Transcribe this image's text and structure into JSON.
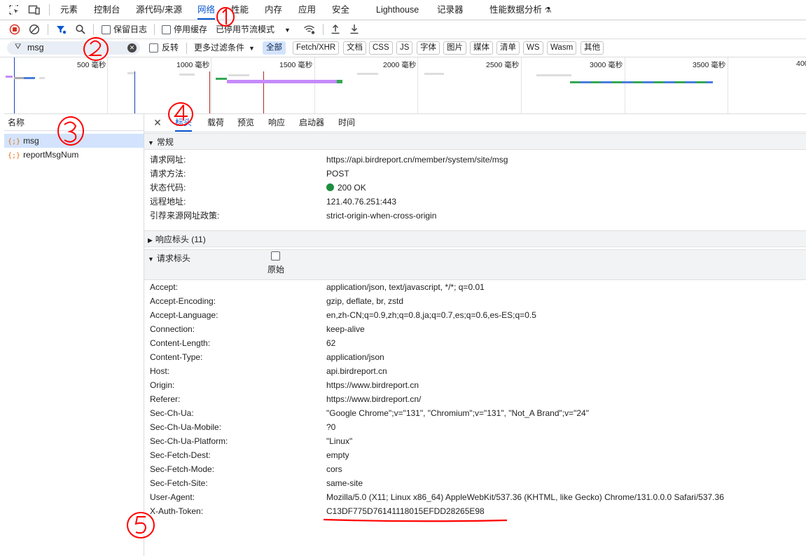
{
  "tabs": {
    "elements": "元素",
    "console": "控制台",
    "sources": "源代码/来源",
    "network": "网络",
    "performance": "性能",
    "memory": "内存",
    "application": "应用",
    "security": "安全",
    "lighthouse": "Lighthouse",
    "recorder": "记录器",
    "performance_insights": "性能数据分析"
  },
  "toolbar": {
    "preserve_log": "保留日志",
    "disable_cache": "停用缓存",
    "throttling": "已停用节流模式"
  },
  "filter": {
    "value": "msg",
    "invert": "反转",
    "more_filters": "更多过滤条件",
    "types": [
      "全部",
      "Fetch/XHR",
      "文档",
      "CSS",
      "JS",
      "字体",
      "图片",
      "媒体",
      "清单",
      "WS",
      "Wasm",
      "其他"
    ],
    "active_type": "全部"
  },
  "timeline": {
    "ticks": [
      "500 毫秒",
      "1000 毫秒",
      "1500 毫秒",
      "2000 毫秒",
      "2500 毫秒",
      "3000 毫秒",
      "3500 毫秒",
      "400"
    ]
  },
  "requests": {
    "header": "名称",
    "items": [
      {
        "name": "msg",
        "selected": true
      },
      {
        "name": "reportMsgNum",
        "selected": false
      }
    ]
  },
  "details": {
    "tabs": [
      "标头",
      "载荷",
      "预览",
      "响应",
      "启动器",
      "时间"
    ],
    "active_tab": "标头",
    "general": {
      "title": "常规",
      "rows": [
        {
          "key": "请求网址:",
          "value": "https://api.birdreport.cn/member/system/site/msg"
        },
        {
          "key": "请求方法:",
          "value": "POST"
        },
        {
          "key": "状态代码:",
          "value": "200 OK"
        },
        {
          "key": "远程地址:",
          "value": "121.40.76.251:443"
        },
        {
          "key": "引荐来源网址政策:",
          "value": "strict-origin-when-cross-origin"
        }
      ]
    },
    "response_headers": {
      "title": "响应标头 (11)"
    },
    "request_headers": {
      "title": "请求标头",
      "raw_label": "原始",
      "rows": [
        {
          "key": "Accept:",
          "value": "application/json, text/javascript, */*; q=0.01"
        },
        {
          "key": "Accept-Encoding:",
          "value": "gzip, deflate, br, zstd"
        },
        {
          "key": "Accept-Language:",
          "value": "en,zh-CN;q=0.9,zh;q=0.8,ja;q=0.7,es;q=0.6,es-ES;q=0.5"
        },
        {
          "key": "Connection:",
          "value": "keep-alive"
        },
        {
          "key": "Content-Length:",
          "value": "62"
        },
        {
          "key": "Content-Type:",
          "value": "application/json"
        },
        {
          "key": "Host:",
          "value": "api.birdreport.cn"
        },
        {
          "key": "Origin:",
          "value": "https://www.birdreport.cn"
        },
        {
          "key": "Referer:",
          "value": "https://www.birdreport.cn/"
        },
        {
          "key": "Sec-Ch-Ua:",
          "value": "\"Google Chrome\";v=\"131\", \"Chromium\";v=\"131\", \"Not_A Brand\";v=\"24\""
        },
        {
          "key": "Sec-Ch-Ua-Mobile:",
          "value": "?0"
        },
        {
          "key": "Sec-Ch-Ua-Platform:",
          "value": "\"Linux\""
        },
        {
          "key": "Sec-Fetch-Dest:",
          "value": "empty"
        },
        {
          "key": "Sec-Fetch-Mode:",
          "value": "cors"
        },
        {
          "key": "Sec-Fetch-Site:",
          "value": "same-site"
        },
        {
          "key": "User-Agent:",
          "value": "Mozilla/5.0 (X11; Linux x86_64) AppleWebKit/537.36 (KHTML, like Gecko) Chrome/131.0.0.0 Safari/537.36"
        },
        {
          "key": "X-Auth-Token:",
          "value": "C13DF775D76141118015EFDD28265E98"
        }
      ]
    }
  },
  "annotations": [
    "①",
    "②",
    "③",
    "④",
    "⑤"
  ],
  "colors": {
    "accent": "#0b57d0",
    "annotation": "#ff0000",
    "status_ok": "#1e8e3e"
  }
}
